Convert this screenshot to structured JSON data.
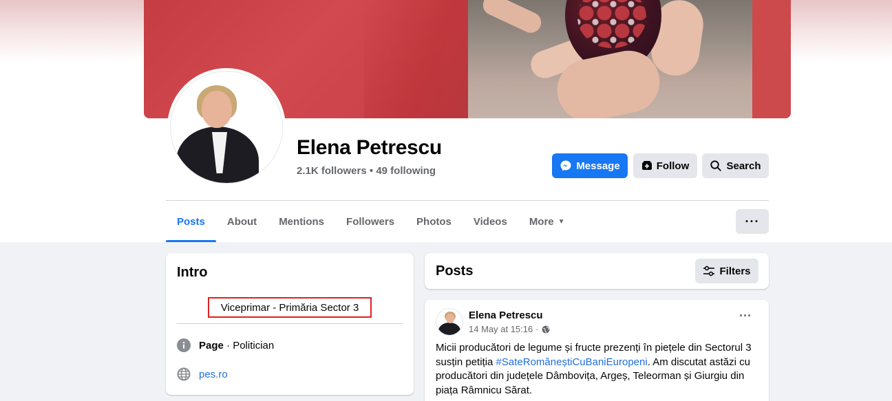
{
  "profile": {
    "name": "Elena Petrescu",
    "followers": "2.1K followers",
    "separator": "•",
    "following": "49 following"
  },
  "actions": {
    "message_label": "Message",
    "follow_label": "Follow",
    "search_label": "Search"
  },
  "tabs": [
    {
      "label": "Posts",
      "active": true
    },
    {
      "label": "About"
    },
    {
      "label": "Mentions"
    },
    {
      "label": "Followers"
    },
    {
      "label": "Photos"
    },
    {
      "label": "Videos"
    },
    {
      "label": "More"
    }
  ],
  "intro": {
    "title": "Intro",
    "bio": "Viceprimar - Primăria Sector 3",
    "category_label": "Page",
    "category_separator": " · ",
    "category_value": "Politician",
    "website": "pes.ro"
  },
  "posts_header": {
    "title": "Posts",
    "filters_label": "Filters"
  },
  "post": {
    "author": "Elena Petrescu",
    "timestamp": "14 May at 15:16",
    "meta_dot": "·",
    "text_before": "Micii producători de legume și fructe prezenți în piețele din Sectorul 3 susțin petiția ",
    "hashtag": "#SateRomâneștiCuBaniEuropeni",
    "text_after": ". Am discutat astăzi cu producători din județele Dâmbovița, Argeș, Teleorman și Giurgiu din piața Râmnicu Sărat."
  },
  "colors": {
    "accent": "#1877f2",
    "highlight_box": "#e02020",
    "link": "#216fdb"
  },
  "icons": {
    "message": "messenger-icon",
    "follow": "follow-icon",
    "search": "search-icon",
    "more_caret": "caret-down-icon",
    "more_menu": "ellipsis-icon",
    "info": "info-icon",
    "website": "globe-icon",
    "filters": "filters-icon",
    "privacy": "globe-icon"
  }
}
